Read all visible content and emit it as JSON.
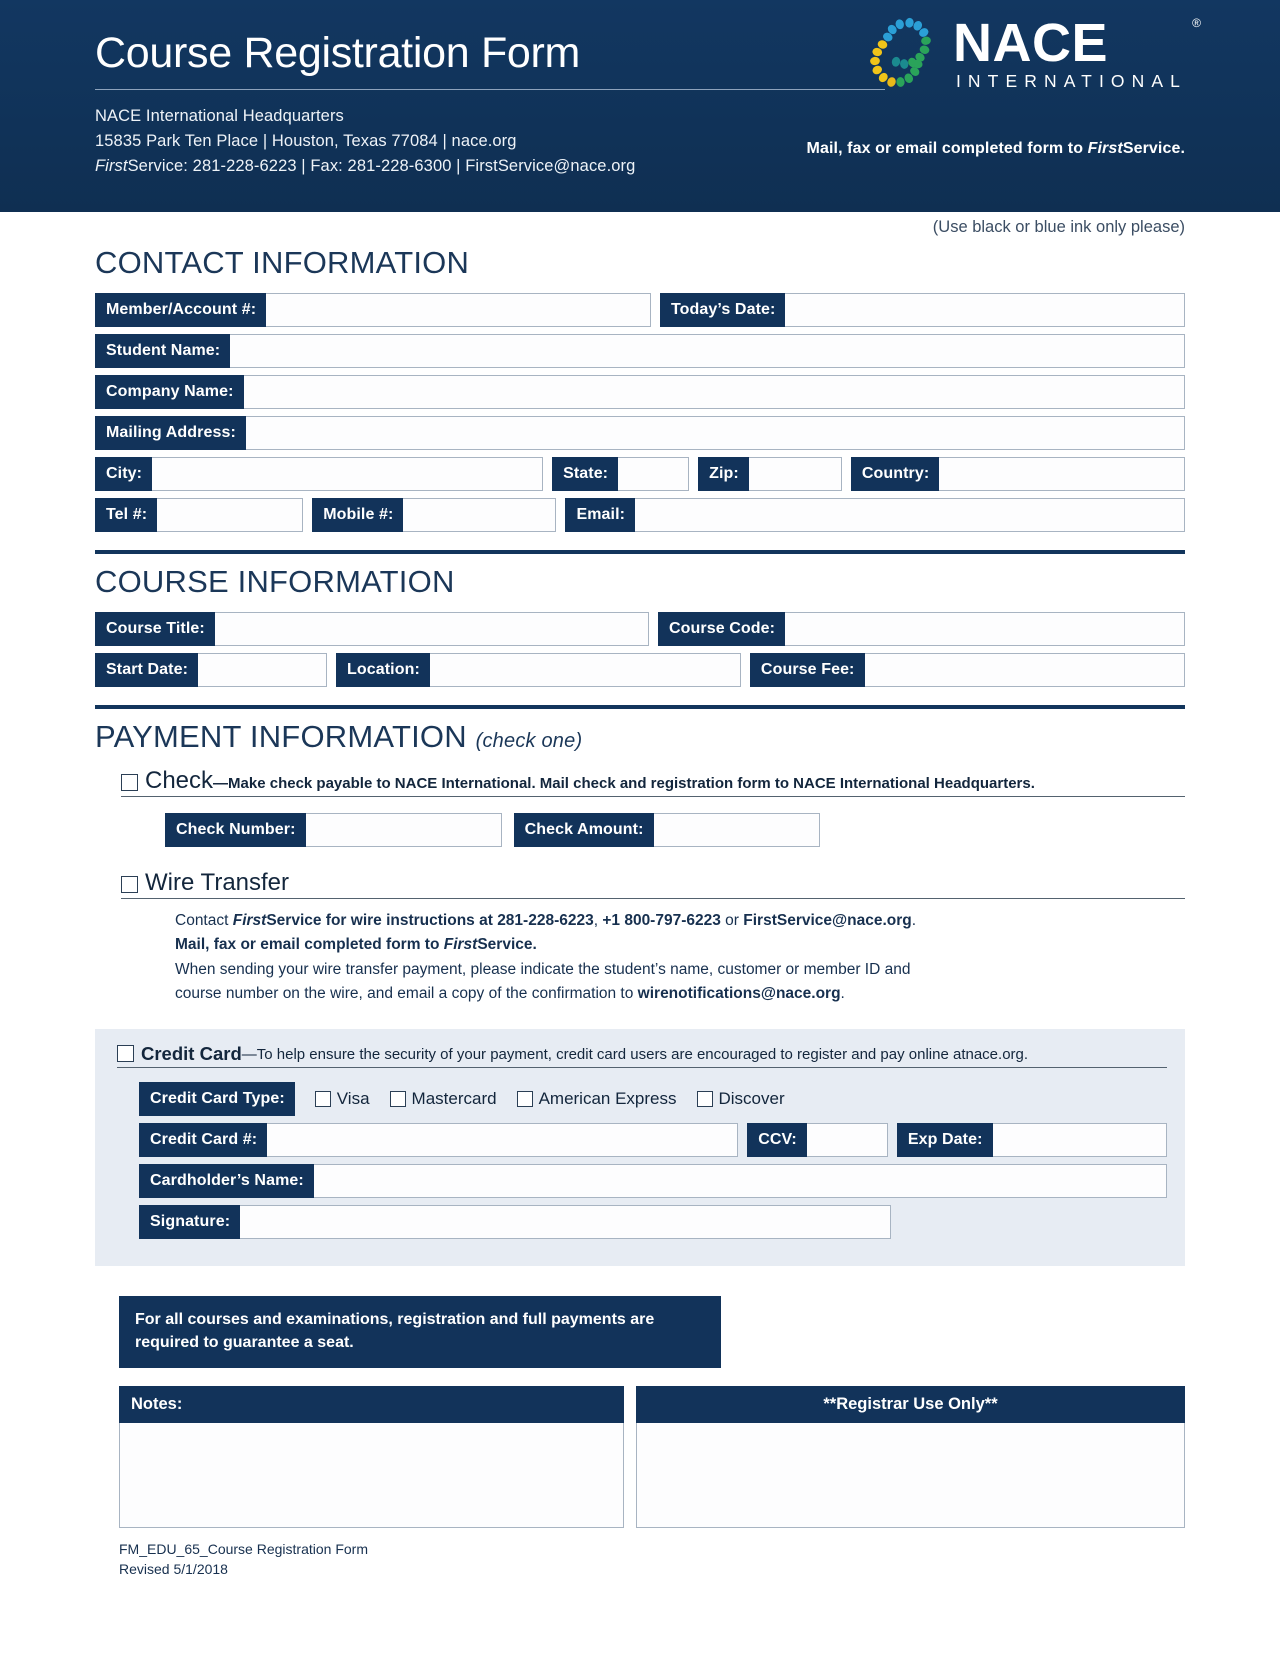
{
  "header": {
    "title": "Course Registration Form",
    "org_name": "NACE International Headquarters",
    "address_line": "15835 Park Ten Place | Houston, Texas 77084 | nace.org",
    "contact_prefix_italic": "First",
    "contact_line": "Service: 281-228-6223 | Fax: 281-228-6300 | FirstService@nace.org",
    "mail_note_pre": "Mail, fax or email completed form to ",
    "mail_note_italic": "First",
    "mail_note_post": "Service.",
    "logo": {
      "wordmark": "NACE",
      "registered": "®",
      "subtitle": "INTERNATIONAL",
      "colors": {
        "blue": "#2b9fd6",
        "green": "#2aa35a",
        "yellow": "#f0c419",
        "teal": "#1b8a8f"
      }
    }
  },
  "ink_note": "(Use black or blue ink only please)",
  "contact": {
    "heading": "CONTACT INFORMATION",
    "labels": {
      "member": "Member/Account #:",
      "today": "Today’s Date:",
      "student": "Student Name:",
      "company": "Company Name:",
      "mailing": "Mailing Address:",
      "city": "City:",
      "state": "State:",
      "zip": "Zip:",
      "country": "Country:",
      "tel": "Tel #:",
      "mobile": "Mobile #:",
      "email": "Email:"
    },
    "values": {
      "member": "",
      "today": "",
      "student": "",
      "company": "",
      "mailing": "",
      "city": "",
      "state": "",
      "zip": "",
      "country": "",
      "tel": "",
      "mobile": "",
      "email": ""
    }
  },
  "course": {
    "heading": "COURSE INFORMATION",
    "labels": {
      "title": "Course Title:",
      "code": "Course Code:",
      "start": "Start Date:",
      "location": "Location:",
      "fee": "Course Fee:"
    },
    "values": {
      "title": "",
      "code": "",
      "start": "",
      "location": "",
      "fee": ""
    }
  },
  "payment": {
    "heading": "PAYMENT INFORMATION",
    "heading_sub": "(check one)",
    "check": {
      "option_label": "Check",
      "dash": "—",
      "description": "Make check payable to NACE International. Mail check and registration form to NACE International Headquarters.",
      "number_label": "Check Number:",
      "amount_label": "Check Amount:",
      "number_value": "",
      "amount_value": ""
    },
    "wire": {
      "option_label": "Wire Transfer",
      "line1_a": "Contact ",
      "line1_italic": "First",
      "line1_b": "Service for wire instructions at ",
      "line1_phone1": "281-228-6223",
      "line1_c": ", ",
      "line1_phone2": "+1 800-797-6223",
      "line1_d": " or ",
      "line1_email": "FirstService@nace.org",
      "line1_e": ".",
      "line2_a": "Mail, fax or email completed form to ",
      "line2_italic": "First",
      "line2_b": "Service.",
      "line3": "When sending your wire transfer payment, please indicate the student’s name, customer or member ID and",
      "line4_a": "course number on the wire, and email a copy of the confirmation to ",
      "line4_email": "wirenotifications@nace.org",
      "line4_b": "."
    },
    "credit": {
      "option_label": "Credit Card",
      "dash": "—",
      "description_a": "To help ensure the security of your payment, credit card users are encouraged to register and pay online at ",
      "description_site": "nace.org",
      "description_b": ".",
      "type_label": "Credit Card Type:",
      "types": [
        "Visa",
        "Mastercard",
        "American Express",
        "Discover"
      ],
      "number_label": "Credit Card #:",
      "ccv_label": "CCV:",
      "exp_label": "Exp Date:",
      "holder_label": "Cardholder’s Name:",
      "signature_label": "Signature:",
      "number_value": "",
      "ccv_value": "",
      "exp_value": "",
      "holder_value": "",
      "signature_value": ""
    }
  },
  "notice": "For all courses and examinations, registration and full payments are required to guarantee a seat.",
  "notes": {
    "heading": "Notes:",
    "value": ""
  },
  "registrar": {
    "heading": "**Registrar Use Only**",
    "value": ""
  },
  "footer": {
    "form_id": "FM_EDU_65_Course Registration Form",
    "revised": "Revised 5/1/2018"
  }
}
